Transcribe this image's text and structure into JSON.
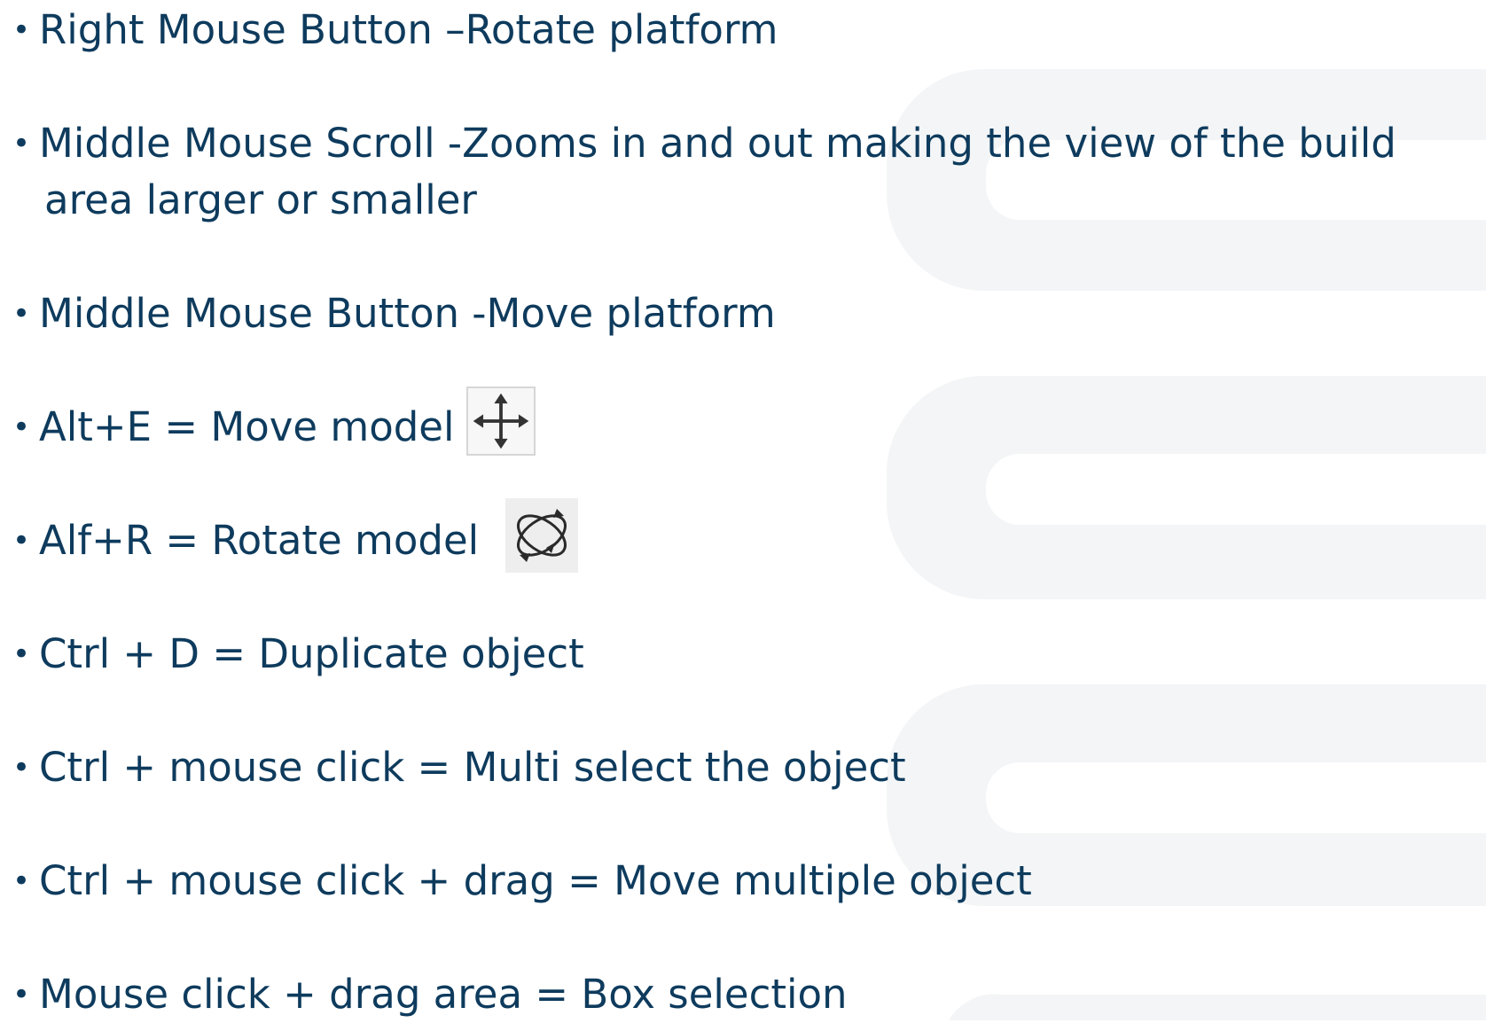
{
  "items": [
    {
      "text": "Right Mouse Button –Rotate platform"
    },
    {
      "text": "Middle Mouse Scroll -Zooms in and out making the view of the build",
      "continuation": "area larger or smaller"
    },
    {
      "text": "Middle Mouse Button -Move platform"
    },
    {
      "text": "Alt+E = Move model",
      "icon": "move-arrows-icon"
    },
    {
      "text": "Alf+R = Rotate model",
      "icon": "rotate-orbit-icon"
    },
    {
      "text": "Ctrl + D = Duplicate object"
    },
    {
      "text": "Ctrl + mouse click = Multi select the object"
    },
    {
      "text": "Ctrl + mouse click + drag = Move multiple object"
    },
    {
      "text": "Mouse click + drag area = Box selection"
    }
  ],
  "colors": {
    "text": "#0e3b5d",
    "background_decoration": "#f3f5f6"
  }
}
